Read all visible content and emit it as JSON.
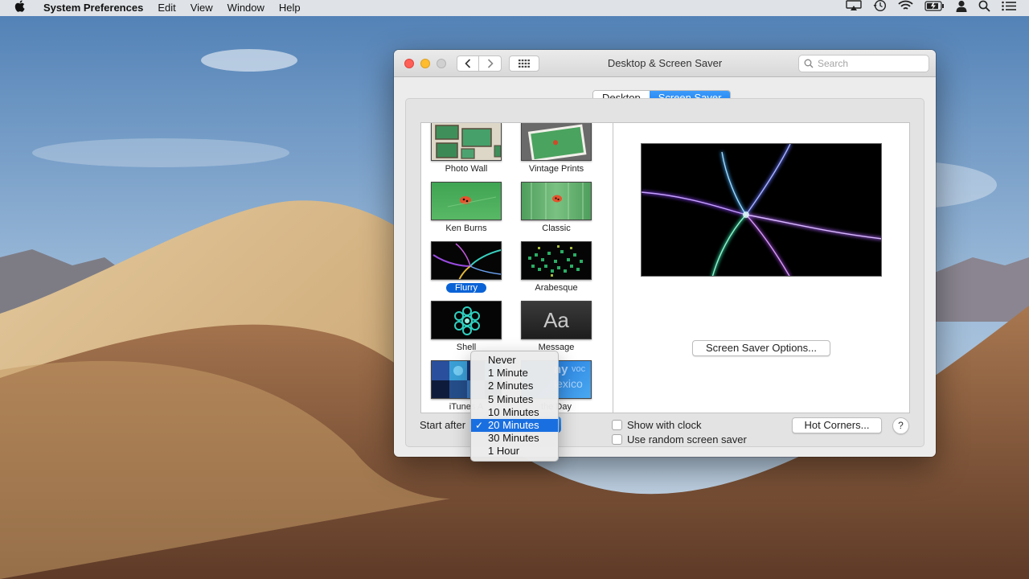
{
  "menubar": {
    "app_name": "System Preferences",
    "items": [
      "Edit",
      "View",
      "Window",
      "Help"
    ],
    "status_icons": [
      "airplay-icon",
      "time-machine-icon",
      "wifi-icon",
      "battery-icon",
      "user-icon",
      "spotlight-icon",
      "notification-center-icon"
    ]
  },
  "window": {
    "title": "Desktop & Screen Saver",
    "search_placeholder": "Search",
    "tabs": [
      {
        "label": "Desktop",
        "active": false
      },
      {
        "label": "Screen Saver",
        "active": true
      }
    ]
  },
  "screensavers": [
    {
      "label": "Photo Wall",
      "selected": false
    },
    {
      "label": "Vintage Prints",
      "selected": false
    },
    {
      "label": "Ken Burns",
      "selected": false
    },
    {
      "label": "Classic",
      "selected": false
    },
    {
      "label": "Flurry",
      "selected": true
    },
    {
      "label": "Arabesque",
      "selected": false
    },
    {
      "label": "Shell",
      "selected": false
    },
    {
      "label": "Message",
      "selected": false
    },
    {
      "label": "iTunes A",
      "selected": false
    },
    {
      "label": "the Day",
      "selected": false
    }
  ],
  "thumb_texts": {
    "message": "Aa",
    "word_of_day_1": "ny",
    "word_of_day_2": "voc",
    "word_of_day_3": "lexico"
  },
  "preview": {
    "options_button": "Screen Saver Options..."
  },
  "controls": {
    "start_after_label": "Start after",
    "show_with_clock": "Show with clock",
    "use_random": "Use random screen saver",
    "hot_corners": "Hot Corners...",
    "help": "?"
  },
  "dropdown": {
    "options": [
      "Never",
      "1 Minute",
      "2 Minutes",
      "5 Minutes",
      "10 Minutes",
      "20 Minutes",
      "30 Minutes",
      "1 Hour"
    ],
    "selected": "20 Minutes",
    "check": "✓"
  }
}
